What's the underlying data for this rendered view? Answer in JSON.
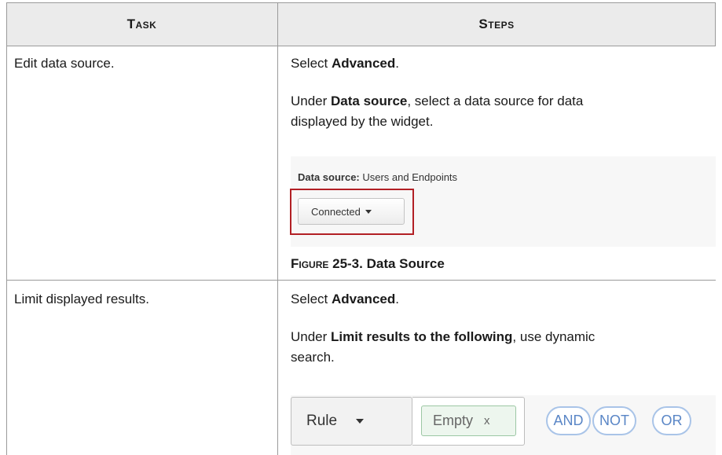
{
  "table": {
    "headers": {
      "task": "Task",
      "steps": "Steps"
    },
    "rows": [
      {
        "task": "Edit data source.",
        "step1_prefix": "Select ",
        "step1_bold": "Advanced",
        "step1_suffix": ".",
        "step2_prefix": "Under ",
        "step2_bold": "Data source",
        "step2_suffix_line1": ", select a data source for data",
        "step2_line2": "displayed by the widget.",
        "figure": {
          "label": "Data source:",
          "value": " Users and Endpoints",
          "dropdown_value": "Connected"
        },
        "caption_label": "Figure 25-3.",
        "caption_title": " Data Source"
      },
      {
        "task": "Limit displayed results.",
        "step1_prefix": "Select ",
        "step1_bold": "Advanced",
        "step1_suffix": ".",
        "step2_prefix": "Under ",
        "step2_bold": "Limit results to the following",
        "step2_suffix_line1": ", use dynamic",
        "step2_line2": "search.",
        "figure": {
          "rule_dropdown": "Rule",
          "chip_text": "Empty",
          "chip_remove": "x",
          "operators": [
            "AND",
            "NOT",
            "OR"
          ]
        }
      }
    ]
  }
}
